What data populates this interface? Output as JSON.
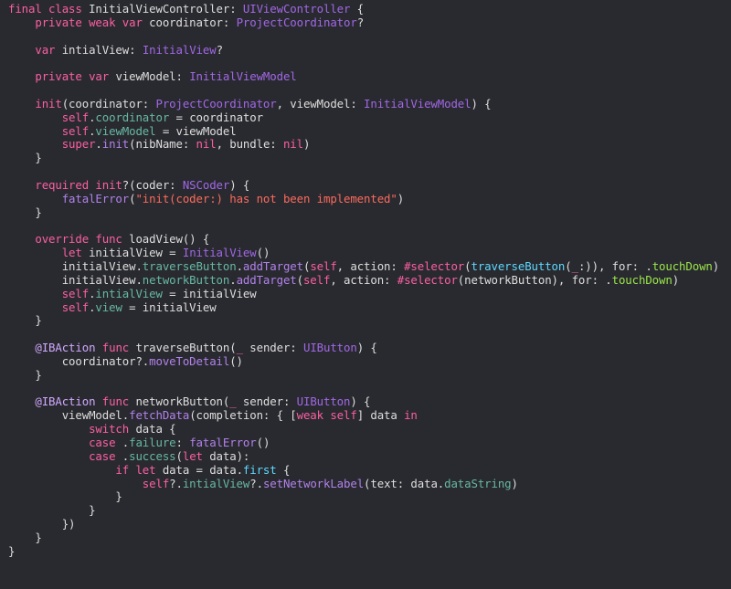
{
  "theme": {
    "background": "#292a2f",
    "plain": "#dedede",
    "keyword": "#fc5fa3",
    "type": "#a167e6",
    "project_member": "#67b7a4",
    "project_method": "#b281eb",
    "other_method": "#5dd8ff",
    "string": "#fc6a5d",
    "enum_case": "#9ae64a",
    "attribute": "#d0a8ff",
    "selector_name": "#5dd8ff"
  },
  "code_lines": [
    [
      [
        "final class ",
        "keyword"
      ],
      [
        "InitialViewController",
        "plain"
      ],
      [
        ": ",
        "plain"
      ],
      [
        "UIViewController",
        "type"
      ],
      [
        " {",
        "plain"
      ]
    ],
    [
      [
        "    private weak var ",
        "keyword"
      ],
      [
        "coordinator",
        "plain"
      ],
      [
        ": ",
        "plain"
      ],
      [
        "ProjectCoordinator",
        "type"
      ],
      [
        "?",
        "plain"
      ]
    ],
    [],
    [
      [
        "    var ",
        "keyword"
      ],
      [
        "intialView",
        "plain"
      ],
      [
        ": ",
        "plain"
      ],
      [
        "InitialView",
        "type"
      ],
      [
        "?",
        "plain"
      ]
    ],
    [],
    [
      [
        "    private var ",
        "keyword"
      ],
      [
        "viewModel",
        "plain"
      ],
      [
        ": ",
        "plain"
      ],
      [
        "InitialViewModel",
        "type"
      ]
    ],
    [],
    [
      [
        "    init",
        "keyword"
      ],
      [
        "(coordinator: ",
        "plain"
      ],
      [
        "ProjectCoordinator",
        "type"
      ],
      [
        ", viewModel: ",
        "plain"
      ],
      [
        "InitialViewModel",
        "type"
      ],
      [
        ") {",
        "plain"
      ]
    ],
    [
      [
        "        self",
        "keyword"
      ],
      [
        ".",
        "plain"
      ],
      [
        "coordinator",
        "project_member"
      ],
      [
        " = coordinator",
        "plain"
      ]
    ],
    [
      [
        "        self",
        "keyword"
      ],
      [
        ".",
        "plain"
      ],
      [
        "viewModel",
        "project_member"
      ],
      [
        " = viewModel",
        "plain"
      ]
    ],
    [
      [
        "        super",
        "keyword"
      ],
      [
        ".",
        "plain"
      ],
      [
        "init",
        "project_method"
      ],
      [
        "(nibName: ",
        "plain"
      ],
      [
        "nil",
        "keyword"
      ],
      [
        ", bundle: ",
        "plain"
      ],
      [
        "nil",
        "keyword"
      ],
      [
        ")",
        "plain"
      ]
    ],
    [
      [
        "    }",
        "plain"
      ]
    ],
    [],
    [
      [
        "    required init",
        "keyword"
      ],
      [
        "?(coder: ",
        "plain"
      ],
      [
        "NSCoder",
        "type"
      ],
      [
        ") {",
        "plain"
      ]
    ],
    [
      [
        "        ",
        "plain"
      ],
      [
        "fatalError",
        "project_method"
      ],
      [
        "(",
        "plain"
      ],
      [
        "\"init(coder:) has not been implemented\"",
        "string"
      ],
      [
        ")",
        "plain"
      ]
    ],
    [
      [
        "    }",
        "plain"
      ]
    ],
    [],
    [
      [
        "    override func ",
        "keyword"
      ],
      [
        "loadView",
        "plain"
      ],
      [
        "() {",
        "plain"
      ]
    ],
    [
      [
        "        let ",
        "keyword"
      ],
      [
        "initialView",
        "plain"
      ],
      [
        " = ",
        "plain"
      ],
      [
        "InitialView",
        "type"
      ],
      [
        "()",
        "plain"
      ]
    ],
    [
      [
        "        initialView.",
        "plain"
      ],
      [
        "traverseButton",
        "project_member"
      ],
      [
        ".",
        "plain"
      ],
      [
        "addTarget",
        "project_method"
      ],
      [
        "(",
        "plain"
      ],
      [
        "self",
        "keyword"
      ],
      [
        ", action: ",
        "plain"
      ],
      [
        "#selector",
        "keyword"
      ],
      [
        "(",
        "plain"
      ],
      [
        "traverseButton",
        "selector_name"
      ],
      [
        "(",
        "plain"
      ],
      [
        "_",
        "keyword"
      ],
      [
        ":)), for: .",
        "plain"
      ],
      [
        "touchDown",
        "enum_case"
      ],
      [
        ")",
        "plain"
      ]
    ],
    [
      [
        "        initialView.",
        "plain"
      ],
      [
        "networkButton",
        "project_member"
      ],
      [
        ".",
        "plain"
      ],
      [
        "addTarget",
        "project_method"
      ],
      [
        "(",
        "plain"
      ],
      [
        "self",
        "keyword"
      ],
      [
        ", action: ",
        "plain"
      ],
      [
        "#selector",
        "keyword"
      ],
      [
        "(networkButton), for: .",
        "plain"
      ],
      [
        "touchDown",
        "enum_case"
      ],
      [
        ")",
        "plain"
      ]
    ],
    [
      [
        "        self",
        "keyword"
      ],
      [
        ".",
        "plain"
      ],
      [
        "intialView",
        "project_member"
      ],
      [
        " = initialView",
        "plain"
      ]
    ],
    [
      [
        "        self",
        "keyword"
      ],
      [
        ".",
        "plain"
      ],
      [
        "view",
        "project_member"
      ],
      [
        " = initialView",
        "plain"
      ]
    ],
    [
      [
        "    }",
        "plain"
      ]
    ],
    [],
    [
      [
        "    @IBAction",
        "attribute"
      ],
      [
        " ",
        "plain"
      ],
      [
        "func ",
        "keyword"
      ],
      [
        "traverseButton",
        "plain"
      ],
      [
        "(",
        "plain"
      ],
      [
        "_",
        "keyword"
      ],
      [
        " sender: ",
        "plain"
      ],
      [
        "UIButton",
        "type"
      ],
      [
        ") {",
        "plain"
      ]
    ],
    [
      [
        "        coordinator?.",
        "plain"
      ],
      [
        "moveToDetail",
        "project_method"
      ],
      [
        "()",
        "plain"
      ]
    ],
    [
      [
        "    }",
        "plain"
      ]
    ],
    [],
    [
      [
        "    @IBAction",
        "attribute"
      ],
      [
        " ",
        "plain"
      ],
      [
        "func ",
        "keyword"
      ],
      [
        "networkButton",
        "plain"
      ],
      [
        "(",
        "plain"
      ],
      [
        "_",
        "keyword"
      ],
      [
        " sender: ",
        "plain"
      ],
      [
        "UIButton",
        "type"
      ],
      [
        ") {",
        "plain"
      ]
    ],
    [
      [
        "        viewModel.",
        "plain"
      ],
      [
        "fetchData",
        "project_method"
      ],
      [
        "(completion: { [",
        "plain"
      ],
      [
        "weak self",
        "keyword"
      ],
      [
        "] data ",
        "plain"
      ],
      [
        "in",
        "keyword"
      ]
    ],
    [
      [
        "            switch ",
        "keyword"
      ],
      [
        "data {",
        "plain"
      ]
    ],
    [
      [
        "            case ",
        "keyword"
      ],
      [
        ".",
        "plain"
      ],
      [
        "failure",
        "project_member"
      ],
      [
        ": ",
        "plain"
      ],
      [
        "fatalError",
        "project_method"
      ],
      [
        "()",
        "plain"
      ]
    ],
    [
      [
        "            case ",
        "keyword"
      ],
      [
        ".",
        "plain"
      ],
      [
        "success",
        "project_member"
      ],
      [
        "(",
        "plain"
      ],
      [
        "let ",
        "keyword"
      ],
      [
        "data):",
        "plain"
      ]
    ],
    [
      [
        "                if let ",
        "keyword"
      ],
      [
        "data = data.",
        "plain"
      ],
      [
        "first",
        "other_method"
      ],
      [
        " {",
        "plain"
      ]
    ],
    [
      [
        "                    self",
        "keyword"
      ],
      [
        "?.",
        "plain"
      ],
      [
        "intialView",
        "project_member"
      ],
      [
        "?.",
        "plain"
      ],
      [
        "setNetworkLabel",
        "project_method"
      ],
      [
        "(text: data.",
        "plain"
      ],
      [
        "dataString",
        "project_member"
      ],
      [
        ")",
        "plain"
      ]
    ],
    [
      [
        "                }",
        "plain"
      ]
    ],
    [
      [
        "            }",
        "plain"
      ]
    ],
    [
      [
        "        })",
        "plain"
      ]
    ],
    [
      [
        "    }",
        "plain"
      ]
    ],
    [
      [
        "}",
        "plain"
      ]
    ]
  ]
}
